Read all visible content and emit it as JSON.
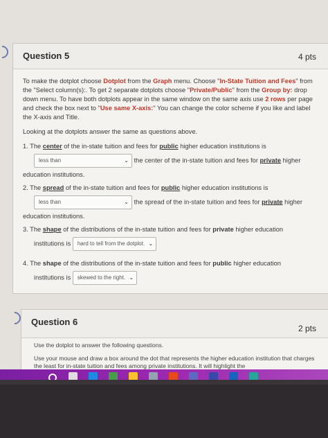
{
  "q5": {
    "title": "Question 5",
    "points": "4 pts",
    "instructions": [
      {
        "t": "To make the dotplot choose "
      },
      {
        "t": "Dotplot",
        "c": "red"
      },
      {
        "t": " from the "
      },
      {
        "t": "Graph",
        "c": "red"
      },
      {
        "t": " menu. Choose \""
      },
      {
        "t": "In-State Tuition and Fees",
        "c": "red"
      },
      {
        "t": "\" from the \"Select column(s):. To get 2 separate dotplots choose \""
      },
      {
        "t": "Private/Public",
        "c": "red"
      },
      {
        "t": "\" from the "
      },
      {
        "t": "Group by:",
        "c": "red"
      },
      {
        "t": " drop down menu. To have both dotplots appear in the same window on the same axis use "
      },
      {
        "t": "2 rows",
        "c": "red"
      },
      {
        "t": " per page and check the box next to \""
      },
      {
        "t": "Use same X-axis:",
        "c": "red"
      },
      {
        "t": "\" You can change the color scheme if you like and label the X-axis and Title."
      }
    ],
    "lead": "Looking at the dotplots answer the same as questions above.",
    "items": [
      {
        "num": "1.",
        "q_parts": [
          {
            "t": "The "
          },
          {
            "t": "center",
            "c": "hl"
          },
          {
            "t": " of the in-state tuition and fees for "
          },
          {
            "t": "public",
            "c": "hl"
          },
          {
            "t": " higher education institutions is"
          }
        ],
        "dropdown": "less than",
        "after_parts": [
          {
            "t": " the center of the in-state tuition and fees for "
          },
          {
            "t": "private",
            "c": "hl"
          },
          {
            "t": " higher"
          }
        ],
        "tail": "education institutions."
      },
      {
        "num": "2.",
        "q_parts": [
          {
            "t": "The "
          },
          {
            "t": "spread",
            "c": "hl"
          },
          {
            "t": " of the in-state tuition and fees for "
          },
          {
            "t": "public",
            "c": "hl"
          },
          {
            "t": " higher education institutions is"
          }
        ],
        "dropdown": "less than",
        "after_parts": [
          {
            "t": " the spread of the in-state tuition and fees for "
          },
          {
            "t": "private",
            "c": "hl"
          },
          {
            "t": " higher"
          }
        ],
        "tail": "education institutions."
      },
      {
        "num": "3.",
        "q_parts": [
          {
            "t": "The "
          },
          {
            "t": "shape",
            "c": "hl"
          },
          {
            "t": " of the distributions of the in-state tuition and fees for "
          },
          {
            "t": "private",
            "c": "b"
          },
          {
            "t": " higher education"
          }
        ],
        "pre": "institutions is",
        "dropdown": "hard to tell from the dotplot."
      },
      {
        "num": "4.",
        "q_parts": [
          {
            "t": "The "
          },
          {
            "t": "shape",
            "c": "b"
          },
          {
            "t": " of the distributions of the in-state tuition and fees for "
          },
          {
            "t": "public",
            "c": "b"
          },
          {
            "t": " higher education"
          }
        ],
        "pre": "institutions is",
        "dropdown": "skewed to the right."
      }
    ]
  },
  "q6": {
    "title": "Question 6",
    "points": "2 pts",
    "line1": "Use the dotplot to answer the following questions.",
    "line2": "Use your mouse and draw a box around the dot that represents the higher education institution that charges the least for in-state tuition and fees among private institutions. It will highlight the"
  },
  "taskbar": {
    "icons": [
      "start-icon",
      "task-view-icon",
      "edge-icon",
      "chrome-icon",
      "file-explorer-icon",
      "store-icon",
      "powerpoint-icon",
      "app-icon",
      "teams-icon",
      "word-icon",
      "browser-icon"
    ]
  }
}
